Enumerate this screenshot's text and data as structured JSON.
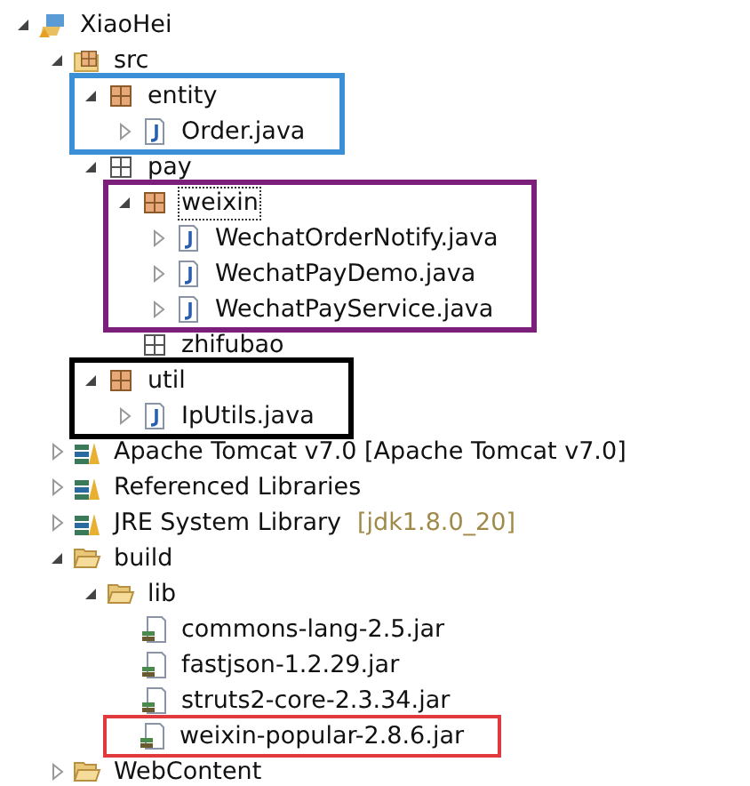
{
  "tree": [
    {
      "kind": "project",
      "label": "XiaoHei",
      "expanded": true,
      "selected": false,
      "children": [
        {
          "kind": "source-folder",
          "label": "src",
          "expanded": true,
          "selected": false,
          "children": [
            {
              "kind": "package",
              "label": "entity",
              "expanded": true,
              "selected": false,
              "color": "#3a8fd6",
              "children": [
                {
                  "kind": "java-file",
                  "label": "Order.java",
                  "expanded": false,
                  "selected": false
                }
              ]
            },
            {
              "kind": "empty-package",
              "label": "pay",
              "expanded": true,
              "selected": false,
              "children": [
                {
                  "kind": "package",
                  "label": "weixin",
                  "expanded": true,
                  "selected": true,
                  "color": "#7b1f7b",
                  "children": [
                    {
                      "kind": "java-file",
                      "label": "WechatOrderNotify.java",
                      "expanded": false,
                      "selected": false
                    },
                    {
                      "kind": "java-file",
                      "label": "WechatPayDemo.java",
                      "expanded": false,
                      "selected": false
                    },
                    {
                      "kind": "java-file",
                      "label": "WechatPayService.java",
                      "expanded": false,
                      "selected": false
                    }
                  ]
                },
                {
                  "kind": "empty-package",
                  "label": "zhifubao",
                  "selected": false
                }
              ]
            },
            {
              "kind": "package",
              "label": "util",
              "expanded": true,
              "selected": false,
              "color": "#000000",
              "children": [
                {
                  "kind": "java-file",
                  "label": "IpUtils.java",
                  "expanded": false,
                  "selected": false
                }
              ]
            }
          ]
        },
        {
          "kind": "library",
          "label": "Apache Tomcat v7.0 [Apache Tomcat v7.0]",
          "expanded": false,
          "selected": false
        },
        {
          "kind": "library",
          "label": "Referenced Libraries",
          "expanded": false,
          "selected": false
        },
        {
          "kind": "library",
          "label": "JRE System Library",
          "decoration": "[jdk1.8.0_20]",
          "expanded": false,
          "selected": false
        },
        {
          "kind": "folder",
          "label": "build",
          "expanded": true,
          "selected": false,
          "children": [
            {
              "kind": "folder",
              "label": "lib",
              "expanded": true,
              "selected": false,
              "children": [
                {
                  "kind": "jar",
                  "label": "commons-lang-2.5.jar",
                  "selected": false
                },
                {
                  "kind": "jar",
                  "label": "fastjson-1.2.29.jar",
                  "selected": false
                },
                {
                  "kind": "jar",
                  "label": "struts2-core-2.3.34.jar",
                  "selected": false
                },
                {
                  "kind": "jar",
                  "label": "weixin-popular-2.8.6.jar",
                  "selected": false,
                  "color": "#e0393e"
                }
              ]
            }
          ]
        },
        {
          "kind": "folder",
          "label": "WebContent",
          "expanded": false,
          "selected": false
        }
      ]
    }
  ]
}
